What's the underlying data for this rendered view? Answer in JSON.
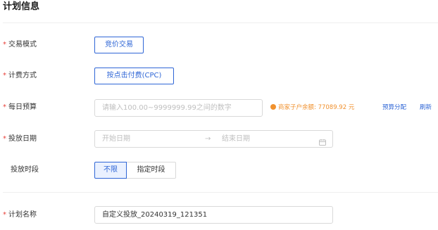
{
  "section_title": "计划信息",
  "fields": {
    "trade_mode": {
      "label": "交易模式",
      "required": true,
      "value": "竞价交易"
    },
    "billing": {
      "label": "计费方式",
      "required": true,
      "value": "按点击付费(CPC)"
    },
    "daily_budget": {
      "label": "每日预算",
      "required": true,
      "placeholder": "请输入100.00~9999999.99之间的数字",
      "balance_text": "商家子户余额: 77089.92 元",
      "allocate_link": "预算分配",
      "refresh_link": "刷新"
    },
    "dates": {
      "label": "投放日期",
      "required": true,
      "start_placeholder": "开始日期",
      "separator": "→",
      "end_placeholder": "结束日期"
    },
    "time_slot": {
      "label": "投放时段",
      "required": false,
      "options": [
        "不限",
        "指定时段"
      ],
      "selected": "不限"
    },
    "plan_name": {
      "label": "计划名称",
      "required": true,
      "value": "自定义投放_20240319_121351"
    }
  },
  "colors": {
    "primary": "#2f66d6",
    "required": "#e8413a",
    "warning": "#f0912e"
  }
}
